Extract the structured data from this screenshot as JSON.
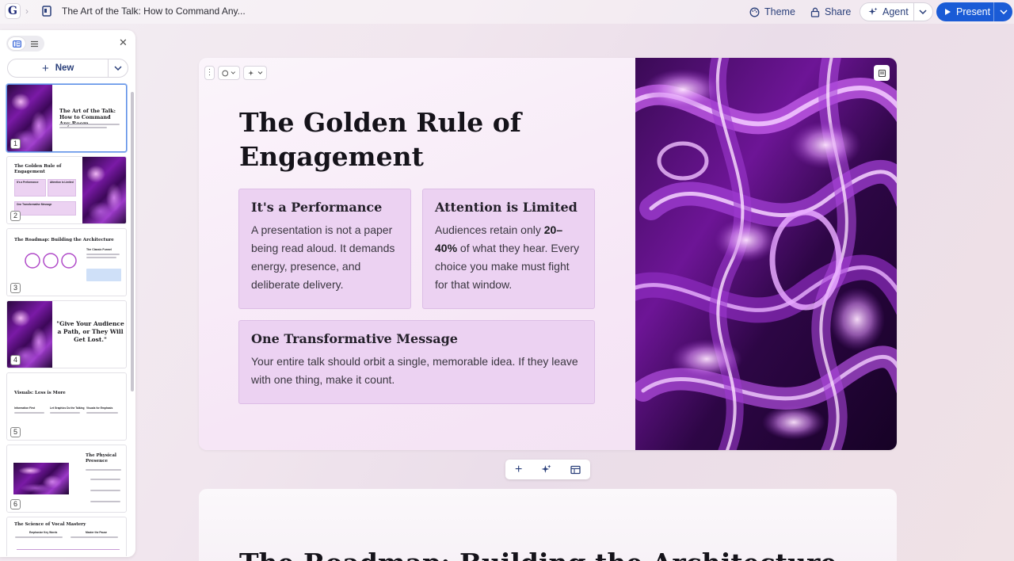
{
  "topbar": {
    "logo": "G",
    "doc_title": "The Art of the Talk: How to Command Any...",
    "theme_label": "Theme",
    "share_label": "Share",
    "agent_label": "Agent",
    "present_label": "Present"
  },
  "sidebar": {
    "new_label": "New",
    "thumbnails": [
      {
        "number": "1",
        "title": "The Art of the Talk: How to Command Any Room"
      },
      {
        "number": "2",
        "title": "The Golden Rule of Engagement",
        "cards": [
          "It's a Performance",
          "Attention is Limited",
          "One Transformative Message"
        ]
      },
      {
        "number": "3",
        "title": "The Roadmap: Building the Architecture",
        "aside_title": "The Classic Funnel"
      },
      {
        "number": "4",
        "title": "\"Give Your Audience a Path, or They Will Get Lost.\""
      },
      {
        "number": "5",
        "title": "Visuals: Less is More",
        "cols": [
          "Information First",
          "Let Graphics Do the Talking",
          "Visuals for Emphasis"
        ]
      },
      {
        "number": "6",
        "title": "The Physical Presence"
      },
      {
        "number": "7",
        "title": "The Science of Vocal Mastery",
        "cols": [
          "Emphasize Key Words",
          "Master the Pause"
        ]
      }
    ]
  },
  "slide": {
    "title": "The Golden Rule of Engagement",
    "cards": [
      {
        "heading": "It's a Performance",
        "body": "A presentation is not a paper being read aloud. It demands energy, presence, and deliberate delivery."
      },
      {
        "heading": "Attention is Limited",
        "body_pre": "Audiences retain only ",
        "body_bold": "20–40%",
        "body_post": " of what they hear. Every choice you make must fight for that window."
      },
      {
        "heading": "One Transformative Message",
        "body": "Your entire talk should orbit a single, memorable idea. If they leave with one thing, make it count."
      }
    ]
  },
  "next_slide": {
    "title": "The Roadmap: Building the Architecture"
  },
  "colors": {
    "accent_blue": "#1a5bd6",
    "card_bg": "#ecd2f2",
    "chrome_purple": "#7a1aa6"
  }
}
